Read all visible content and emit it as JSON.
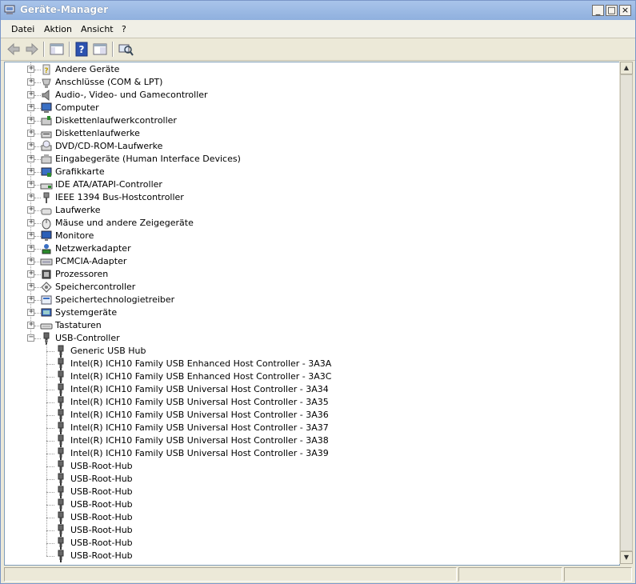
{
  "window": {
    "title": "Geräte-Manager",
    "controls": {
      "minimize": "_",
      "maximize": "□",
      "close": "×"
    }
  },
  "menu": [
    "Datei",
    "Aktion",
    "Ansicht",
    "?"
  ],
  "toolbar": [
    "back-icon",
    "forward-icon",
    "show-hide-console-tree-icon",
    "help-icon",
    "properties-icon",
    "scan-hardware-icon"
  ],
  "tree": {
    "categories": [
      {
        "label": "Andere Geräte",
        "icon": "unknown-device-icon",
        "expanded": false
      },
      {
        "label": "Anschlüsse (COM & LPT)",
        "icon": "port-icon",
        "expanded": false
      },
      {
        "label": "Audio-, Video- und Gamecontroller",
        "icon": "speaker-icon",
        "expanded": false
      },
      {
        "label": "Computer",
        "icon": "computer-icon",
        "expanded": false
      },
      {
        "label": "Diskettenlaufwerkcontroller",
        "icon": "floppy-controller-icon",
        "expanded": false
      },
      {
        "label": "Diskettenlaufwerke",
        "icon": "floppy-drive-icon",
        "expanded": false
      },
      {
        "label": "DVD/CD-ROM-Laufwerke",
        "icon": "cdrom-icon",
        "expanded": false
      },
      {
        "label": "Eingabegeräte (Human Interface Devices)",
        "icon": "hid-icon",
        "expanded": false
      },
      {
        "label": "Grafikkarte",
        "icon": "display-adapter-icon",
        "expanded": false
      },
      {
        "label": "IDE ATA/ATAPI-Controller",
        "icon": "ide-controller-icon",
        "expanded": false
      },
      {
        "label": "IEEE 1394 Bus-Hostcontroller",
        "icon": "firewire-icon",
        "expanded": false
      },
      {
        "label": "Laufwerke",
        "icon": "disk-drive-icon",
        "expanded": false
      },
      {
        "label": "Mäuse und andere Zeigegeräte",
        "icon": "mouse-icon",
        "expanded": false
      },
      {
        "label": "Monitore",
        "icon": "monitor-icon",
        "expanded": false
      },
      {
        "label": "Netzwerkadapter",
        "icon": "network-adapter-icon",
        "expanded": false
      },
      {
        "label": "PCMCIA-Adapter",
        "icon": "pcmcia-icon",
        "expanded": false
      },
      {
        "label": "Prozessoren",
        "icon": "processor-icon",
        "expanded": false
      },
      {
        "label": "Speichercontroller",
        "icon": "storage-controller-icon",
        "expanded": false
      },
      {
        "label": "Speichertechnologietreiber",
        "icon": "storage-driver-icon",
        "expanded": false
      },
      {
        "label": "Systemgeräte",
        "icon": "system-device-icon",
        "expanded": false
      },
      {
        "label": "Tastaturen",
        "icon": "keyboard-icon",
        "expanded": false
      },
      {
        "label": "USB-Controller",
        "icon": "usb-icon",
        "expanded": true,
        "children": [
          "Generic USB Hub",
          "Intel(R) ICH10 Family USB Enhanced Host Controller - 3A3A",
          "Intel(R) ICH10 Family USB Enhanced Host Controller - 3A3C",
          "Intel(R) ICH10 Family USB Universal Host Controller - 3A34",
          "Intel(R) ICH10 Family USB Universal Host Controller - 3A35",
          "Intel(R) ICH10 Family USB Universal Host Controller - 3A36",
          "Intel(R) ICH10 Family USB Universal Host Controller - 3A37",
          "Intel(R) ICH10 Family USB Universal Host Controller - 3A38",
          "Intel(R) ICH10 Family USB Universal Host Controller - 3A39",
          "USB-Root-Hub",
          "USB-Root-Hub",
          "USB-Root-Hub",
          "USB-Root-Hub",
          "USB-Root-Hub",
          "USB-Root-Hub",
          "USB-Root-Hub",
          "USB-Root-Hub"
        ]
      }
    ]
  },
  "expander_glyphs": {
    "collapsed": "+",
    "expanded": "−"
  },
  "scrollbar": {
    "up": "▲",
    "down": "▼"
  },
  "colors": {
    "titlebar": "#a9c4ea",
    "tree_bg": "#ffffff",
    "usb_icon": "#555555"
  }
}
